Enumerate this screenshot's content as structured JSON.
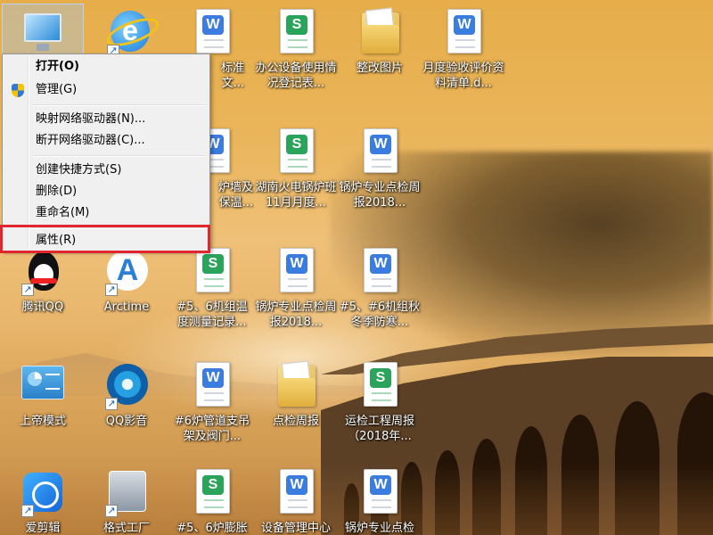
{
  "desktop_icons": [
    {
      "id": "computer",
      "label": ""
    },
    {
      "id": "ie",
      "label": ""
    },
    {
      "id": "doc1",
      "label": "标准\n文..."
    },
    {
      "id": "office-equip",
      "label": "办公设备使用情况登记表..."
    },
    {
      "id": "rectify-pics",
      "label": "整改图片"
    },
    {
      "id": "monthly-accept",
      "label": "月度验收评价资料清单.d..."
    },
    {
      "id": "doc-wall",
      "label": "炉墙及\n保温..."
    },
    {
      "id": "hunan-boiler",
      "label": "湖南火电锅炉班11月月度..."
    },
    {
      "id": "boiler-weekly-1",
      "label": "锅炉专业点检周报2018..."
    },
    {
      "id": "tencent-qq",
      "label": "腾讯QQ"
    },
    {
      "id": "arctime",
      "label": "Arctime"
    },
    {
      "id": "unit56-temp",
      "label": "#5、6机组温度测量记录..."
    },
    {
      "id": "boiler-weekly-2",
      "label": "锅炉专业点检周报2018..."
    },
    {
      "id": "unit56-winter",
      "label": "#5、#6机组秋冬季防寒..."
    },
    {
      "id": "god-mode",
      "label": "上帝模式"
    },
    {
      "id": "qq-player",
      "label": "QQ影音"
    },
    {
      "id": "boiler6-pipe",
      "label": "#6炉管道支吊架及阀门..."
    },
    {
      "id": "inspection-weekly",
      "label": "点检周报"
    },
    {
      "id": "maintenance-weekly",
      "label": "运检工程周报（2018年..."
    },
    {
      "id": "aijianji",
      "label": "爱剪辑"
    },
    {
      "id": "format-factory",
      "label": "格式工厂"
    },
    {
      "id": "unit56-expansion",
      "label": "#5、6炉膨胀"
    },
    {
      "id": "equipment-center",
      "label": "设备管理中心"
    },
    {
      "id": "boiler-weekly-3",
      "label": "锅炉专业点检"
    }
  ],
  "context_menu": {
    "items": [
      {
        "label": "打开(O)"
      },
      {
        "label": "管理(G)"
      },
      {
        "label": "映射网络驱动器(N)..."
      },
      {
        "label": "断开网络驱动器(C)..."
      },
      {
        "label": "创建快捷方式(S)"
      },
      {
        "label": "删除(D)"
      },
      {
        "label": "重命名(M)"
      },
      {
        "label": "属性(R)"
      }
    ]
  },
  "colors": {
    "highlight_border": "#e0262e",
    "word_badge": "#3a7ce0",
    "sheet_badge": "#2aa35b"
  }
}
